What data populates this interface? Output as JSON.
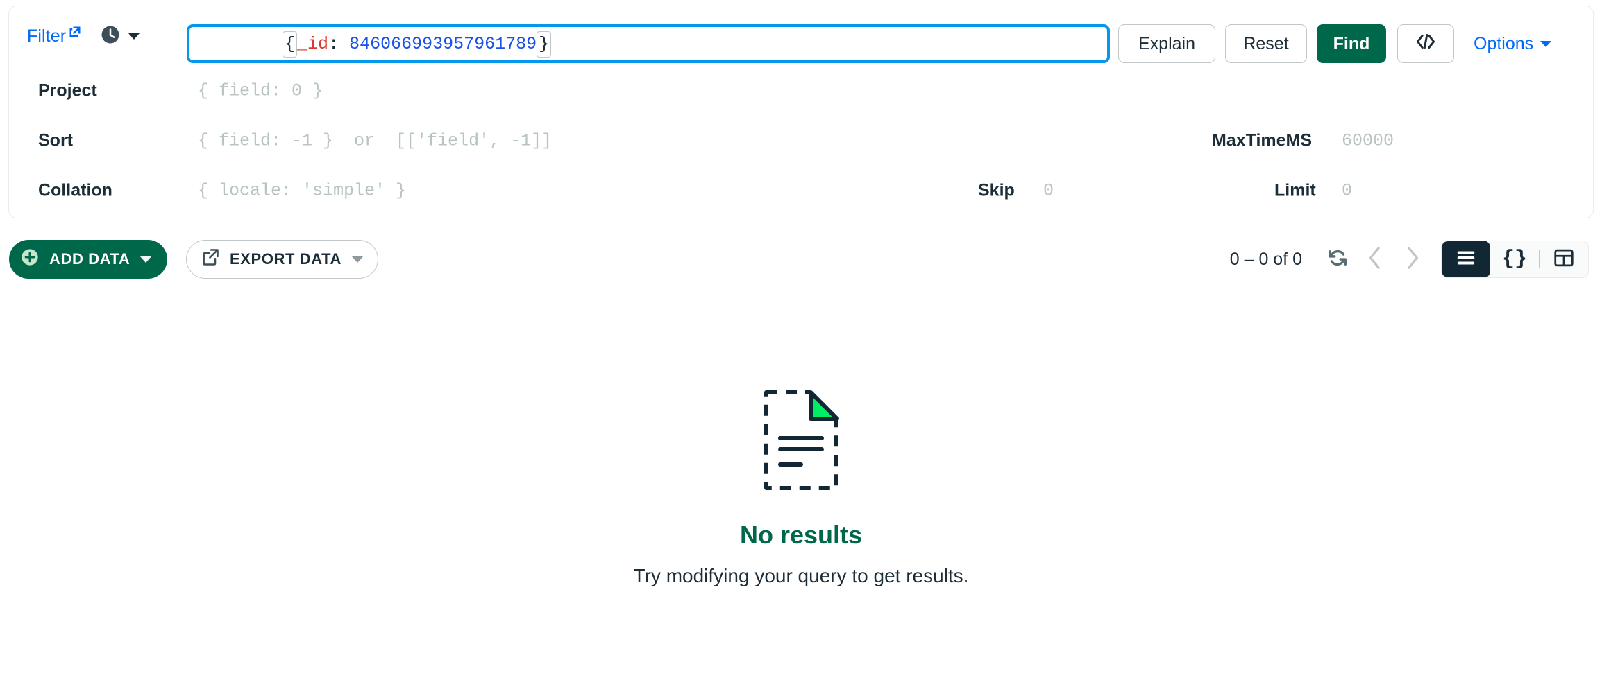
{
  "query_bar": {
    "filter_label": "Filter",
    "filter_link_icon": "external-link-icon",
    "history_icon": "clock-icon",
    "history_caret_icon": "chevron-down-icon",
    "filter_value_prefix": "{",
    "filter_value_key": "_id",
    "filter_value_colon": ": ",
    "filter_value_number": "846066993957961789",
    "filter_value_suffix": "}",
    "filter_value_full": "{_id: 846066993957961789}",
    "explain_label": "Explain",
    "reset_label": "Reset",
    "find_label": "Find",
    "export_to_language_icon": "code-brackets-icon",
    "options_label": "Options",
    "options_caret_icon": "chevron-down-icon",
    "fields": {
      "project_label": "Project",
      "project_placeholder": "{ field: 0 }",
      "sort_label": "Sort",
      "sort_placeholder": "{ field: -1 }  or  [['field', -1]]",
      "collation_label": "Collation",
      "collation_placeholder": "{ locale: 'simple' }",
      "maxtimems_label": "MaxTimeMS",
      "maxtimems_placeholder": "60000",
      "skip_label": "Skip",
      "skip_placeholder": "0",
      "limit_label": "Limit",
      "limit_placeholder": "0"
    }
  },
  "toolbar": {
    "add_data_label": "ADD DATA",
    "add_data_icon": "plus-circle-icon",
    "add_data_caret_icon": "caret-down-icon",
    "export_data_label": "EXPORT DATA",
    "export_data_icon": "export-icon",
    "export_data_caret_icon": "caret-down-icon",
    "pagination_count": "0 – 0 of 0",
    "refresh_icon": "refresh-icon",
    "prev_icon": "chevron-left-icon",
    "next_icon": "chevron-right-icon",
    "view_list_icon": "list-view-icon",
    "view_json_icon": "json-view-icon",
    "view_table_icon": "table-view-icon",
    "active_view": "list"
  },
  "empty_state": {
    "icon": "empty-document-icon",
    "title": "No results",
    "subtitle": "Try modifying your query to get results."
  },
  "colors": {
    "accent_green": "#00684A",
    "link_blue": "#016BF8",
    "focus_blue": "#0498EC",
    "code_key_red": "#D83C2E",
    "code_number_blue": "#1750EB",
    "leaf_green": "#00ED64",
    "dark_navy": "#112733",
    "placeholder_gray": "#B8C4C2"
  }
}
